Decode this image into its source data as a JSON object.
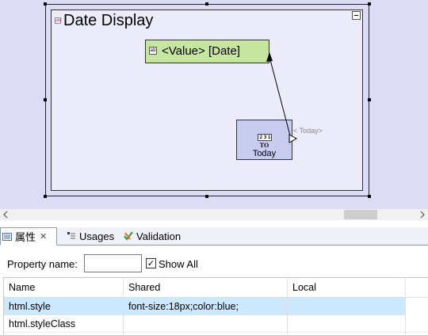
{
  "canvas": {
    "container_title": "Date Display",
    "value_field": "<Value> [Date]",
    "today_node": {
      "icon_text": "2 3 1",
      "code": "TO",
      "label": "Today",
      "port_label": "< Today>"
    }
  },
  "tabs": [
    {
      "label": "属性",
      "icon": "properties-icon",
      "active": true,
      "closable": true
    },
    {
      "label": "Usages",
      "icon": "usages-icon",
      "active": false
    },
    {
      "label": "Validation",
      "icon": "validation-icon",
      "active": false
    }
  ],
  "properties": {
    "name_label": "Property name:",
    "name_value": "",
    "show_all_label": "Show All",
    "show_all_checked": true
  },
  "table": {
    "columns": [
      "Name",
      "Shared",
      "Local",
      ""
    ],
    "rows": [
      {
        "name": "html.style",
        "shared": "font-size:18px;color:blue;",
        "local": "",
        "selected": true
      },
      {
        "name": "html.styleClass",
        "shared": "",
        "local": "",
        "selected": false
      },
      {
        "name": "",
        "shared": "",
        "local": "",
        "selected": false
      }
    ]
  }
}
